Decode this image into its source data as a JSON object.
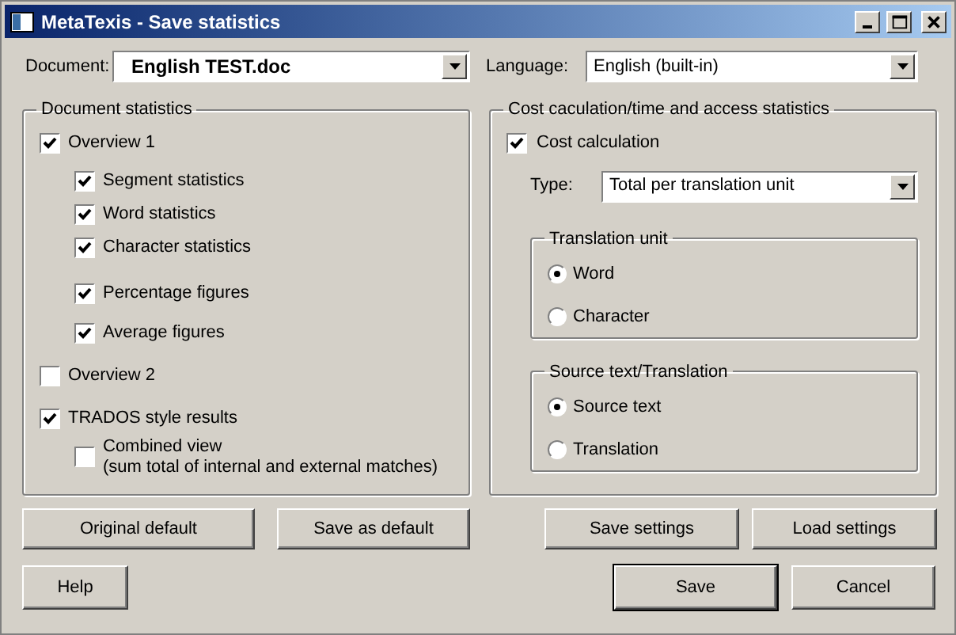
{
  "window": {
    "title": "MetaTexis - Save statistics"
  },
  "document": {
    "label": "Document:",
    "value": "English TEST.doc"
  },
  "language": {
    "label": "Language:",
    "value": "English (built-in)"
  },
  "document_statistics": {
    "title": "Document statistics",
    "items": [
      {
        "label": "Overview 1",
        "checked": true,
        "children": [
          {
            "label": "Segment statistics",
            "checked": true
          },
          {
            "label": "Word statistics",
            "checked": true
          },
          {
            "label": "Character statistics",
            "checked": true
          },
          {
            "label": "Percentage figures",
            "checked": true
          },
          {
            "label": "Average figures",
            "checked": true
          }
        ]
      },
      {
        "label": "Overview 2",
        "checked": false
      },
      {
        "label": "TRADOS style results",
        "checked": true,
        "children": [
          {
            "label": "Combined view",
            "detail": "(sum total of internal and external matches)",
            "checked": false
          }
        ]
      }
    ]
  },
  "cost_statistics": {
    "title": "Cost caculation/time and access statistics",
    "cost_calculation": {
      "label": "Cost calculation",
      "checked": true
    },
    "type": {
      "label": "Type:",
      "value": "Total per translation unit"
    },
    "groups": [
      {
        "title": "Translation unit",
        "options": [
          {
            "label": "Word",
            "selected": true
          },
          {
            "label": "Character",
            "selected": false
          }
        ]
      },
      {
        "title": "Source text/Translation",
        "options": [
          {
            "label": "Source text",
            "selected": true
          },
          {
            "label": "Translation",
            "selected": false
          }
        ]
      }
    ]
  },
  "settings_buttons": [
    "Original default",
    "Save as default",
    "Save settings",
    "Load settings"
  ],
  "dialog_buttons": [
    "Help",
    "Save",
    "Cancel"
  ]
}
